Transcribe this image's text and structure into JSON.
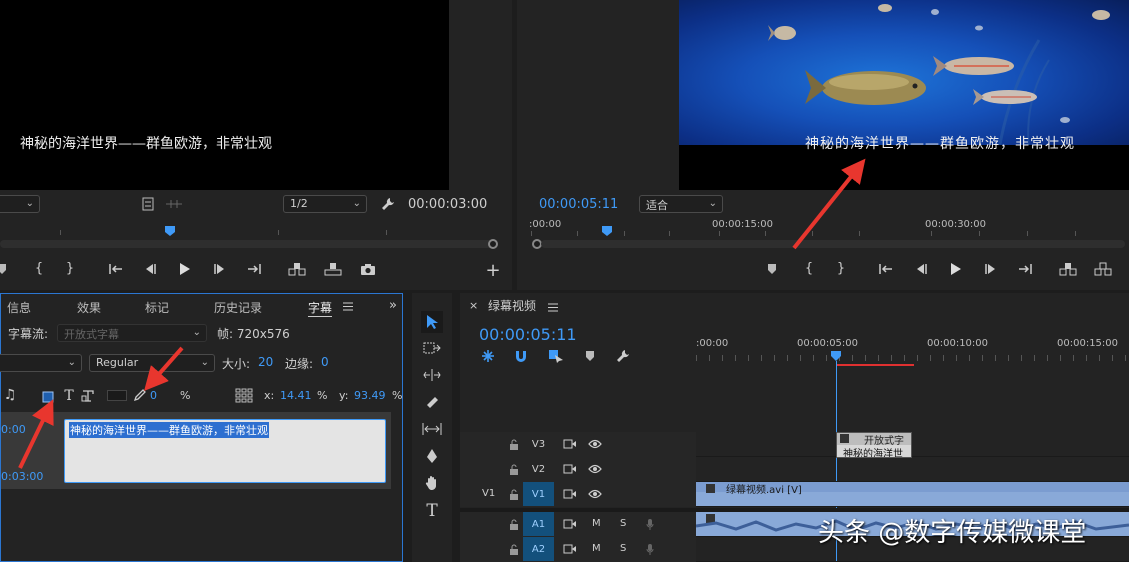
{
  "source_monitor": {
    "caption_text": "神秘的海洋世界——群鱼欧游，非常壮观",
    "resolution": "1/2",
    "timecode": "00:00:03:00"
  },
  "program_monitor": {
    "caption_text": "神秘的海洋世界——群鱼欧游，非常壮观",
    "timecode": "00:00:05:11",
    "zoom": "适合",
    "ruler_labels": [
      ":00:00",
      "00:00:15:00",
      "00:00:30:00"
    ]
  },
  "caption_panel": {
    "tabs": [
      "信息",
      "效果",
      "标记",
      "历史记录",
      "字幕"
    ],
    "stream_label": "字幕流:",
    "stream_value": "开放式字幕",
    "frame_label": "帧: 720x576",
    "font_style": "Regular",
    "size_label": "大小:",
    "size_value": "20",
    "edge_label": "边缘:",
    "edge_value": "0",
    "opacity_value": "0",
    "percent": "%",
    "x_label": "x:",
    "x_value": "14.41",
    "y_label": "y:",
    "y_value": "93.49",
    "in_time": "0:00",
    "out_time": "0:03:00",
    "caption_entry": "神秘的海洋世界——群鱼欧游，非常壮观"
  },
  "timeline": {
    "close_glyph": "×",
    "sequence_name": "绿幕视频",
    "timecode": "00:00:05:11",
    "ruler_labels": [
      ":00:00",
      "00:00:05:00",
      "00:00:10:00",
      "00:00:15:00"
    ],
    "tracks": [
      {
        "id": "V3",
        "source": ""
      },
      {
        "id": "V2",
        "source": ""
      },
      {
        "id": "V1",
        "source": "V1"
      },
      {
        "id": "A1",
        "source": ""
      },
      {
        "id": "A2",
        "source": ""
      }
    ],
    "mute_label": "M",
    "solo_label": "S",
    "caption_clip_title": "开放式字",
    "caption_clip_text": "神秘的海洋世",
    "video_clip_name": "绿幕视频.avi [V]"
  },
  "watermark": "头条 @数字传媒微课堂",
  "colors": {
    "accent_blue": "#3f9af7",
    "selection_border": "#2b76d1",
    "clip_blue": "#89a9d8",
    "work_area_red": "#e03030",
    "arrow_red": "#e8362e"
  }
}
